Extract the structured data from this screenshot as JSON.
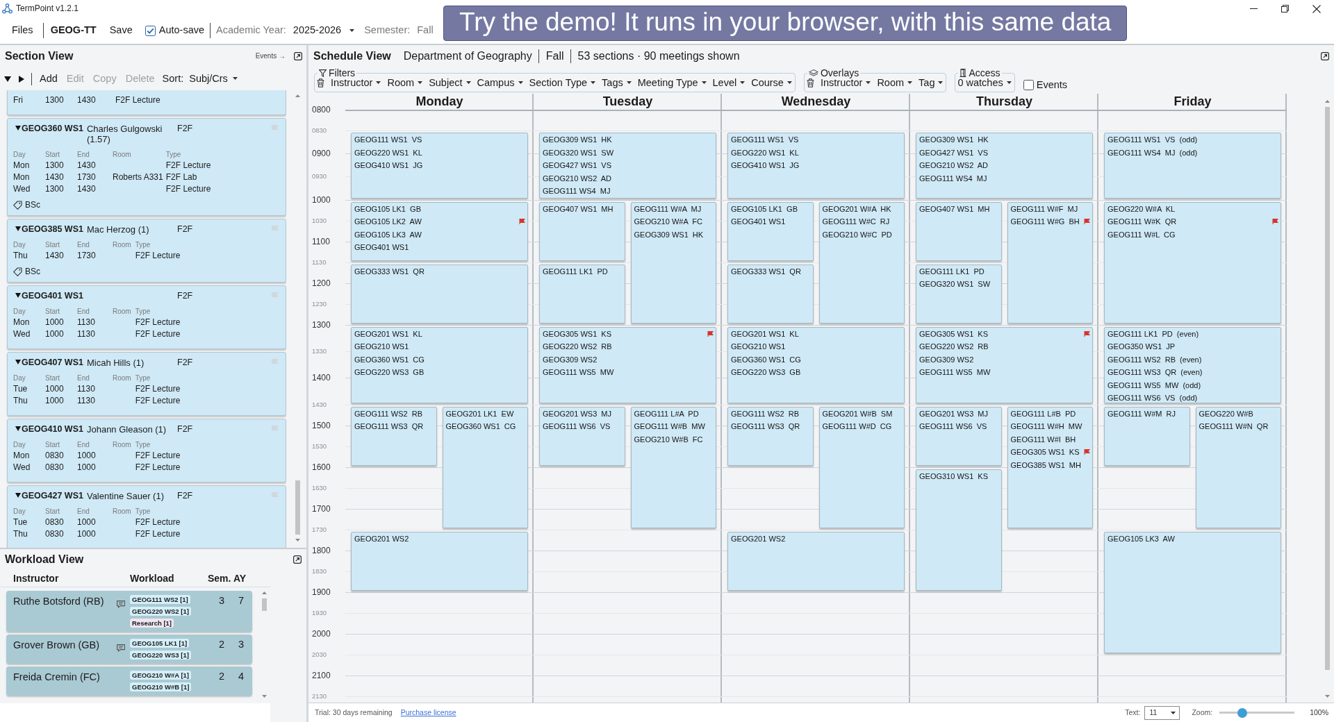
{
  "window": {
    "title": "TermPoint v1.2.1"
  },
  "toolbar": {
    "files": "Files",
    "document": "GEOG-TT",
    "save": "Save",
    "autosave": {
      "label": "Auto-save",
      "checked": true
    },
    "academic_year": {
      "label": "Academic Year:",
      "value": "2025-2026"
    },
    "semester": {
      "label": "Semester:",
      "value": "Fall"
    }
  },
  "demo_callout": {
    "text": "Try the demo! It runs in your browser, with this same data"
  },
  "section_view": {
    "title": "Section View",
    "events_link": "Events →",
    "actions": [
      {
        "label": "Add",
        "disabled": false
      },
      {
        "label": "Edit",
        "disabled": true
      },
      {
        "label": "Copy",
        "disabled": true
      },
      {
        "label": "Delete",
        "disabled": true
      }
    ],
    "sort": {
      "label": "Sort:",
      "value": "Subj/Crs"
    },
    "sections": [
      {
        "expanded": true,
        "meetings": [
          {
            "day": "Fri",
            "start": "1300",
            "end": "1430",
            "type": "F2F Lecture"
          }
        ]
      },
      {
        "code": "GEOG360 WS1",
        "instructor": "Charles Gulgowski (1.57)",
        "mode": "F2F",
        "flagged": false,
        "expanded": true,
        "columns": [
          "Day",
          "Start",
          "End",
          "Room",
          "Type"
        ],
        "meetings": [
          {
            "day": "Mon",
            "start": "1300",
            "end": "1430",
            "type": "F2F Lecture"
          },
          {
            "day": "Mon",
            "start": "1430",
            "end": "1730",
            "room": "Roberts A331",
            "type": "F2F Lab"
          },
          {
            "day": "Wed",
            "start": "1300",
            "end": "1430",
            "type": "F2F Lecture"
          }
        ],
        "tags": [
          "BSc"
        ]
      },
      {
        "code": "GEOG385 WS1",
        "instructor": "Mac Herzog (1)",
        "mode": "F2F",
        "flagged": false,
        "expanded": true,
        "columns": [
          "Day",
          "Start",
          "End",
          "Room",
          "Type"
        ],
        "meetings": [
          {
            "day": "Thu",
            "start": "1430",
            "end": "1730",
            "type": "F2F Lecture"
          }
        ],
        "tags": [
          "BSc"
        ]
      },
      {
        "code": "GEOG401 WS1",
        "mode": "F2F",
        "flagged": false,
        "expanded": true,
        "columns": [
          "Day",
          "Start",
          "End",
          "Room",
          "Type"
        ],
        "meetings": [
          {
            "day": "Mon",
            "start": "1000",
            "end": "1130",
            "type": "F2F Lecture"
          },
          {
            "day": "Wed",
            "start": "1000",
            "end": "1130",
            "type": "F2F Lecture"
          }
        ]
      },
      {
        "code": "GEOG407 WS1",
        "instructor": "Micah Hills (1)",
        "mode": "F2F",
        "flagged": false,
        "expanded": true,
        "columns": [
          "Day",
          "Start",
          "End",
          "Room",
          "Type"
        ],
        "meetings": [
          {
            "day": "Tue",
            "start": "1000",
            "end": "1130",
            "type": "F2F Lecture"
          },
          {
            "day": "Thu",
            "start": "1000",
            "end": "1130",
            "type": "F2F Lecture"
          }
        ]
      },
      {
        "code": "GEOG410 WS1",
        "instructor": "Johann Gleason (1)",
        "mode": "F2F",
        "flagged": false,
        "expanded": true,
        "columns": [
          "Day",
          "Start",
          "End",
          "Room",
          "Type"
        ],
        "meetings": [
          {
            "day": "Mon",
            "start": "0830",
            "end": "1000",
            "type": "F2F Lecture"
          },
          {
            "day": "Wed",
            "start": "0830",
            "end": "1000",
            "type": "F2F Lecture"
          }
        ]
      },
      {
        "code": "GEOG427 WS1",
        "instructor": "Valentine Sauer (1)",
        "mode": "F2F",
        "flagged": false,
        "expanded": true,
        "columns": [
          "Day",
          "Start",
          "End",
          "Room",
          "Type"
        ],
        "meetings": [
          {
            "day": "Tue",
            "start": "0830",
            "end": "1000",
            "type": "F2F Lecture"
          },
          {
            "day": "Thu",
            "start": "0830",
            "end": "1000",
            "type": "F2F Lecture"
          }
        ]
      }
    ]
  },
  "workload_view": {
    "title": "Workload View",
    "columns": [
      "Instructor",
      "Workload",
      "Sem.",
      "AY"
    ],
    "rows": [
      {
        "instructor": "Ruthe Botsford (RB)",
        "note": true,
        "items": [
          {
            "text": "GEOG111 WS2 [1]",
            "kind": "section"
          },
          {
            "text": "GEOG220 WS2 [1]",
            "kind": "section"
          },
          {
            "text": "Research [1]",
            "kind": "activity"
          }
        ],
        "sem": "3",
        "ay": "7"
      },
      {
        "instructor": "Grover Brown (GB)",
        "note": true,
        "items": [
          {
            "text": "GEOG105 LK1 [1]",
            "kind": "section"
          },
          {
            "text": "GEOG220 WS3 [1]",
            "kind": "section"
          }
        ],
        "sem": "2",
        "ay": "3"
      },
      {
        "instructor": "Freida Cremin (FC)",
        "note": false,
        "items": [
          {
            "text": "GEOG210 W#A [1]",
            "kind": "section"
          },
          {
            "text": "GEOG210 W#B [1]",
            "kind": "section"
          }
        ],
        "sem": "2",
        "ay": "4"
      }
    ]
  },
  "schedule_view": {
    "title": "Schedule View",
    "department": "Department of Geography",
    "semester": "Fall",
    "summary": "53 sections · 90 meetings shown",
    "groups": [
      {
        "kind": "filters",
        "label": "Filters",
        "dropdowns": [
          "Instructor",
          "Room",
          "Subject",
          "Campus",
          "Section Type",
          "Tags",
          "Meeting Type",
          "Level",
          "Course"
        ]
      },
      {
        "kind": "overlays",
        "label": "Overlays",
        "dropdowns": [
          "Instructor",
          "Room",
          "Tag"
        ]
      },
      {
        "kind": "access",
        "label": "Access",
        "dropdowns": [
          "0 watches"
        ]
      }
    ],
    "events": {
      "label": "Events",
      "checked": false
    },
    "time_labels": [
      {
        "text": "0800",
        "kind": "hour"
      },
      {
        "text": "0830",
        "kind": "half"
      },
      {
        "text": "0900",
        "kind": "hour"
      },
      {
        "text": "0930",
        "kind": "half"
      },
      {
        "text": "1000",
        "kind": "hour"
      },
      {
        "text": "1030",
        "kind": "half"
      },
      {
        "text": "1100",
        "kind": "hour"
      },
      {
        "text": "1130",
        "kind": "half"
      },
      {
        "text": "1200",
        "kind": "hour"
      },
      {
        "text": "1230",
        "kind": "half"
      },
      {
        "text": "1300",
        "kind": "hour"
      },
      {
        "text": "1330",
        "kind": "half"
      },
      {
        "text": "1400",
        "kind": "hour"
      },
      {
        "text": "1430",
        "kind": "half"
      },
      {
        "text": "1500",
        "kind": "hour"
      },
      {
        "text": "1530",
        "kind": "half"
      },
      {
        "text": "1600",
        "kind": "hour"
      },
      {
        "text": "1630",
        "kind": "half"
      },
      {
        "text": "1700",
        "kind": "hour"
      },
      {
        "text": "1730",
        "kind": "half"
      },
      {
        "text": "1800",
        "kind": "hour"
      },
      {
        "text": "1830",
        "kind": "half"
      },
      {
        "text": "1900",
        "kind": "hour"
      },
      {
        "text": "1930",
        "kind": "half"
      },
      {
        "text": "2000",
        "kind": "hour"
      },
      {
        "text": "2030",
        "kind": "half"
      },
      {
        "text": "2100",
        "kind": "hour"
      },
      {
        "text": "2130",
        "kind": "half"
      }
    ],
    "days": [
      {
        "name": "Monday",
        "blocks": [
          {
            "kind": "full",
            "entries": [
              {
                "text": "GEOG111 WS1  VS",
                "flagged": false
              },
              {
                "text": "GEOG220 WS1  KL",
                "flagged": false
              },
              {
                "text": "GEOG410 WS1  JG",
                "flagged": false
              }
            ]
          },
          {
            "kind": "full",
            "entries": [
              {
                "text": "GEOG105 LK1  GB",
                "flagged": false
              },
              {
                "text": "GEOG105 LK2  AW",
                "flagged": true
              },
              {
                "text": "GEOG105 LK3  AW",
                "flagged": false
              },
              {
                "text": "GEOG401 WS1",
                "flagged": false
              }
            ]
          },
          {
            "kind": "full",
            "entries": [
              {
                "text": "GEOG333 WS1  QR",
                "flagged": false
              }
            ]
          },
          {
            "kind": "full",
            "entries": [
              {
                "text": "GEOG201 WS1  KL",
                "flagged": false
              },
              {
                "text": "GEOG210 WS1",
                "flagged": false
              },
              {
                "text": "GEOG360 WS1  CG",
                "flagged": false
              },
              {
                "text": "GEOG220 WS3  GB",
                "flagged": false
              }
            ]
          },
          {
            "kind": "left",
            "entries": [
              {
                "text": "GEOG111 WS2  RB",
                "flagged": false
              },
              {
                "text": "GEOG111 WS3  QR",
                "flagged": false
              }
            ]
          },
          {
            "kind": "right",
            "entries": [
              {
                "text": "GEOG201 LK1  EW",
                "flagged": false
              },
              {
                "text": "GEOG360 WS1  CG",
                "flagged": false
              }
            ]
          },
          {
            "kind": "full",
            "entries": [
              {
                "text": "GEOG201 WS2",
                "flagged": false
              }
            ]
          }
        ]
      },
      {
        "name": "Tuesday",
        "blocks": [
          {
            "kind": "full",
            "entries": [
              {
                "text": "GEOG309 WS1  HK",
                "flagged": false
              },
              {
                "text": "GEOG320 WS1  SW",
                "flagged": false
              },
              {
                "text": "GEOG427 WS1  VS",
                "flagged": false
              },
              {
                "text": "GEOG210 WS2  AD",
                "flagged": false
              },
              {
                "text": "GEOG111 WS4  MJ",
                "flagged": false
              }
            ]
          },
          {
            "kind": "left",
            "entries": [
              {
                "text": "GEOG407 WS1  MH",
                "flagged": false
              }
            ]
          },
          {
            "kind": "right",
            "entries": [
              {
                "text": "GEOG111 W#A  MJ",
                "flagged": false
              },
              {
                "text": "GEOG210 W#A  FC",
                "flagged": false
              },
              {
                "text": "GEOG309 WS1  HK",
                "flagged": false
              }
            ]
          },
          {
            "kind": "left",
            "entries": [
              {
                "text": "GEOG111 LK1  PD",
                "flagged": false
              }
            ]
          },
          {
            "kind": "full",
            "entries": [
              {
                "text": "GEOG305 WS1  KS",
                "flagged": true
              },
              {
                "text": "GEOG220 WS2  RB",
                "flagged": false
              },
              {
                "text": "GEOG309 WS2",
                "flagged": false
              },
              {
                "text": "GEOG111 WS5  MW",
                "flagged": false
              }
            ]
          },
          {
            "kind": "left",
            "entries": [
              {
                "text": "GEOG201 WS3  MJ",
                "flagged": false
              },
              {
                "text": "GEOG111 WS6  VS",
                "flagged": false
              }
            ]
          },
          {
            "kind": "right",
            "entries": [
              {
                "text": "GEOG111 L#A  PD",
                "flagged": false
              },
              {
                "text": "GEOG111 W#B  MW",
                "flagged": false
              },
              {
                "text": "GEOG210 W#B  FC",
                "flagged": false
              }
            ]
          }
        ]
      },
      {
        "name": "Wednesday",
        "blocks": [
          {
            "kind": "full",
            "entries": [
              {
                "text": "GEOG111 WS1  VS",
                "flagged": false
              },
              {
                "text": "GEOG220 WS1  KL",
                "flagged": false
              },
              {
                "text": "GEOG410 WS1  JG",
                "flagged": false
              }
            ]
          },
          {
            "kind": "left",
            "entries": [
              {
                "text": "GEOG105 LK1  GB",
                "flagged": false
              },
              {
                "text": "GEOG401 WS1",
                "flagged": false
              }
            ]
          },
          {
            "kind": "right",
            "entries": [
              {
                "text": "GEOG201 W#A  HK",
                "flagged": false
              },
              {
                "text": "GEOG111 W#C  RJ",
                "flagged": false
              },
              {
                "text": "GEOG210 W#C  PD",
                "flagged": false
              }
            ]
          },
          {
            "kind": "left",
            "entries": [
              {
                "text": "GEOG333 WS1  QR",
                "flagged": false
              }
            ]
          },
          {
            "kind": "full",
            "entries": [
              {
                "text": "GEOG201 WS1  KL",
                "flagged": false
              },
              {
                "text": "GEOG210 WS1",
                "flagged": false
              },
              {
                "text": "GEOG360 WS1  CG",
                "flagged": false
              },
              {
                "text": "GEOG220 WS3  GB",
                "flagged": false
              }
            ]
          },
          {
            "kind": "left",
            "entries": [
              {
                "text": "GEOG111 WS2  RB",
                "flagged": false
              },
              {
                "text": "GEOG111 WS3  QR",
                "flagged": false
              }
            ]
          },
          {
            "kind": "right",
            "entries": [
              {
                "text": "GEOG201 W#B  SM",
                "flagged": false
              },
              {
                "text": "GEOG111 W#D  CG",
                "flagged": false
              }
            ]
          },
          {
            "kind": "full",
            "entries": [
              {
                "text": "GEOG201 WS2",
                "flagged": false
              }
            ]
          }
        ]
      },
      {
        "name": "Thursday",
        "blocks": [
          {
            "kind": "full",
            "entries": [
              {
                "text": "GEOG309 WS1  HK",
                "flagged": false
              },
              {
                "text": "GEOG427 WS1  VS",
                "flagged": false
              },
              {
                "text": "GEOG210 WS2  AD",
                "flagged": false
              },
              {
                "text": "GEOG111 WS4  MJ",
                "flagged": false
              }
            ]
          },
          {
            "kind": "left",
            "entries": [
              {
                "text": "GEOG407 WS1  MH",
                "flagged": false
              }
            ]
          },
          {
            "kind": "right",
            "entries": [
              {
                "text": "GEOG111 W#F  MJ",
                "flagged": false
              },
              {
                "text": "GEOG111 W#G  BH",
                "flagged": true
              }
            ]
          },
          {
            "kind": "left",
            "entries": [
              {
                "text": "GEOG111 LK1  PD",
                "flagged": false
              },
              {
                "text": "GEOG320 WS1  SW",
                "flagged": false
              }
            ]
          },
          {
            "kind": "full",
            "entries": [
              {
                "text": "GEOG305 WS1  KS",
                "flagged": true
              },
              {
                "text": "GEOG220 WS2  RB",
                "flagged": false
              },
              {
                "text": "GEOG309 WS2",
                "flagged": false
              },
              {
                "text": "GEOG111 WS5  MW",
                "flagged": false
              }
            ]
          },
          {
            "kind": "left",
            "entries": [
              {
                "text": "GEOG201 WS3  MJ",
                "flagged": false
              },
              {
                "text": "GEOG111 WS6  VS",
                "flagged": false
              }
            ]
          },
          {
            "kind": "right",
            "entries": [
              {
                "text": "GEOG111 L#B  PD",
                "flagged": false
              },
              {
                "text": "GEOG111 W#H  MW",
                "flagged": false
              },
              {
                "text": "GEOG111 W#I  BH",
                "flagged": false
              },
              {
                "text": "GEOG305 WS1  KS",
                "flagged": true
              },
              {
                "text": "GEOG385 WS1  MH",
                "flagged": false
              }
            ]
          },
          {
            "kind": "left",
            "entries": [
              {
                "text": "GEOG310 WS1  KS",
                "flagged": false
              }
            ]
          }
        ]
      },
      {
        "name": "Friday",
        "blocks": [
          {
            "kind": "full",
            "entries": [
              {
                "text": "GEOG111 WS1  VS  (odd)",
                "flagged": false
              },
              {
                "text": "GEOG111 WS4  MJ  (odd)",
                "flagged": false
              }
            ]
          },
          {
            "kind": "full",
            "entries": [
              {
                "text": "GEOG220 W#A  KL",
                "flagged": false
              },
              {
                "text": "GEOG111 W#K  QR",
                "flagged": true
              },
              {
                "text": "GEOG111 W#L  CG",
                "flagged": false
              }
            ]
          },
          {
            "kind": "full",
            "entries": [
              {
                "text": "GEOG111 LK1  PD  (even)",
                "flagged": false
              },
              {
                "text": "GEOG350 WS1  JP",
                "flagged": false
              },
              {
                "text": "GEOG111 WS2  RB  (even)",
                "flagged": false
              },
              {
                "text": "GEOG111 WS3  QR  (even)",
                "flagged": false
              },
              {
                "text": "GEOG111 WS5  MW  (odd)",
                "flagged": false
              },
              {
                "text": "GEOG111 WS6  VS  (odd)",
                "flagged": false
              }
            ]
          },
          {
            "kind": "left",
            "entries": [
              {
                "text": "GEOG111 W#M  RJ",
                "flagged": false
              }
            ]
          },
          {
            "kind": "right",
            "entries": [
              {
                "text": "GEOG220 W#B",
                "flagged": false
              },
              {
                "text": "GEOG111 W#N  QR",
                "flagged": false
              }
            ]
          },
          {
            "kind": "full",
            "entries": [
              {
                "text": "GEOG105 LK3  AW",
                "flagged": false
              }
            ]
          }
        ]
      }
    ]
  },
  "status_bar": {
    "trial": "Trial: 30 days remaining",
    "link": "Purchase license",
    "text_size": {
      "label": "Text:",
      "value": "11"
    },
    "zoom": {
      "label": "Zoom:",
      "level": 0.28,
      "reading": "100%"
    }
  }
}
